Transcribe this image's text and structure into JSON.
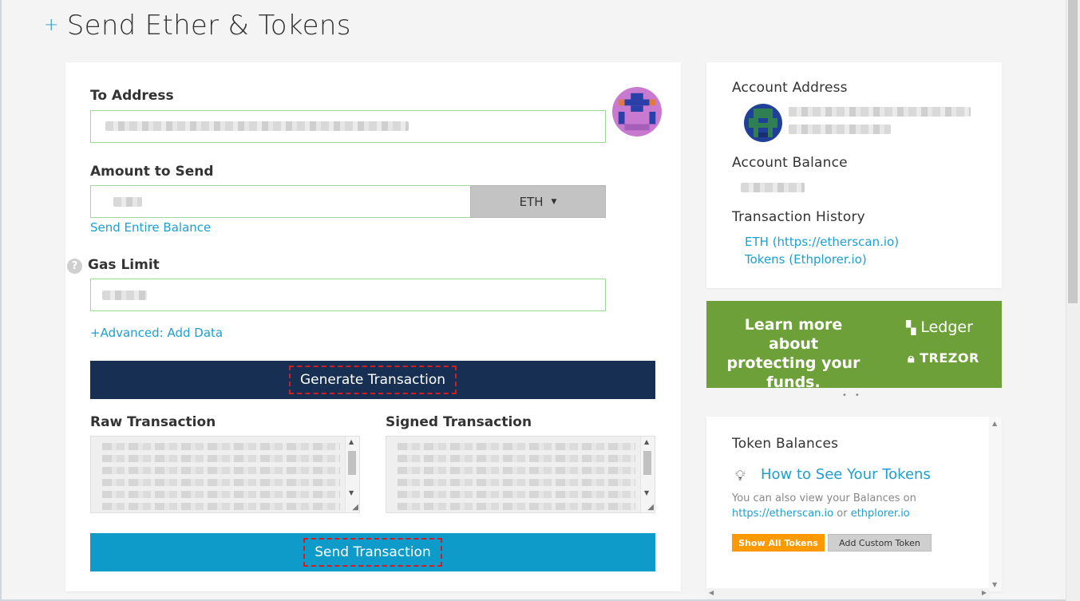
{
  "page": {
    "title": "Send Ether & Tokens",
    "title_icon": "plus-icon"
  },
  "form": {
    "to_address_label": "To Address",
    "amount_label": "Amount to Send",
    "currency": "ETH",
    "send_entire_balance": "Send Entire Balance",
    "gas_limit_label": "Gas Limit",
    "advanced_link": "+Advanced: Add Data",
    "generate_button": "Generate Transaction",
    "raw_transaction_label": "Raw Transaction",
    "signed_transaction_label": "Signed Transaction",
    "send_button": "Send Transaction"
  },
  "account": {
    "address_label": "Account Address",
    "balance_label": "Account Balance",
    "history_label": "Transaction History",
    "history_links": [
      "ETH (https://etherscan.io)",
      "Tokens (Ethplorer.io)"
    ]
  },
  "promo": {
    "text": "Learn more about protecting your funds.",
    "ledger": "Ledger",
    "trezor": "TREZOR"
  },
  "tokens": {
    "title": "Token Balances",
    "howto": "How to See Your Tokens",
    "also_text": "You can also view your Balances on",
    "link1": "https://etherscan.io",
    "or": "or",
    "link2": "ethplorer.io",
    "show_all": "Show All Tokens",
    "add_custom": "Add Custom Token"
  },
  "colors": {
    "accent": "#1d9fd0",
    "generate_bg": "#172f52",
    "send_bg": "#0f9bc9",
    "promo_bg": "#6ea03a",
    "show_all_bg": "#ff9900",
    "highlight": "#d31c24"
  }
}
